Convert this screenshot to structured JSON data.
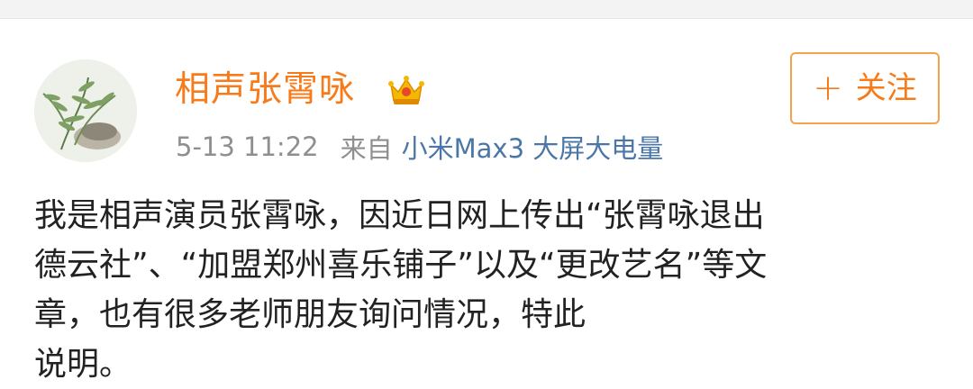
{
  "post": {
    "author": {
      "name": "相声张霄咏",
      "vip_badge_icon": "crown-vip-icon",
      "avatar_icon": "plant-avatar-icon"
    },
    "follow_button": {
      "plus": "+",
      "label": "关注"
    },
    "meta": {
      "time": "5-13 11:22",
      "from_label": "来自",
      "device": "小米Max3 大屏大电量"
    },
    "content_lines": [
      "我是相声演员张霄咏，因近日网上传出“张霄咏退出",
      "德云社”、“加盟郑州喜乐铺子”以及“更改艺名”等文",
      "章，也有很多老师朋友询问情况，特此",
      "说明。"
    ]
  },
  "colors": {
    "accent_orange": "#f77b1a",
    "link_blue": "#4a76a8",
    "meta_gray": "#8f8f8f",
    "text_dark": "#222222"
  }
}
